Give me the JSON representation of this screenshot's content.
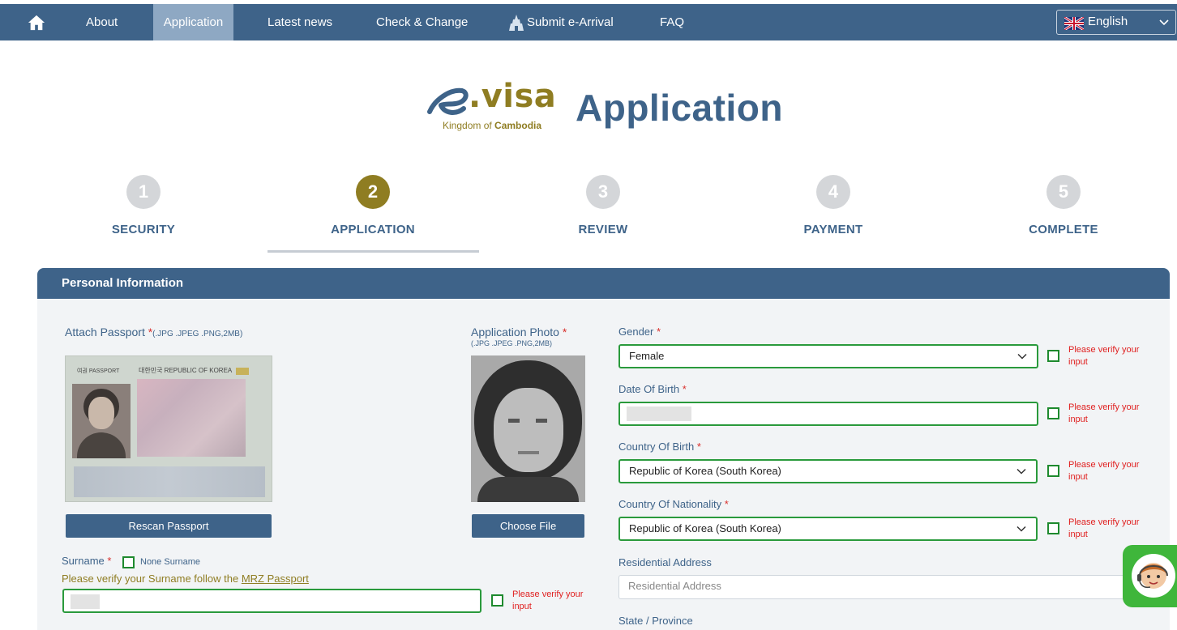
{
  "nav": {
    "items": [
      "About",
      "Application",
      "Latest news",
      "Check & Change",
      "Submit e-Arrival",
      "FAQ"
    ],
    "language": "English"
  },
  "logo": {
    "brand": "e.visa",
    "subtitle_plain": "Kingdom of ",
    "subtitle_bold": "Cambodia"
  },
  "page_title": "Application",
  "steps": [
    {
      "num": "1",
      "label": "SECURITY"
    },
    {
      "num": "2",
      "label": "APPLICATION"
    },
    {
      "num": "3",
      "label": "REVIEW"
    },
    {
      "num": "4",
      "label": "PAYMENT"
    },
    {
      "num": "5",
      "label": "COMPLETE"
    }
  ],
  "panel": {
    "title": "Personal Information"
  },
  "passport": {
    "label": "Attach Passport",
    "required": "*",
    "formats": "(.JPG .JPEG .PNG,2MB)",
    "button": "Rescan Passport",
    "header_left": "여권 PASSPORT",
    "header_right": "대한민국  REPUBLIC OF KOREA"
  },
  "photo": {
    "label": "Application Photo",
    "required": "*",
    "formats": "(.JPG .JPEG .PNG,2MB)",
    "button": "Choose File"
  },
  "surname": {
    "label": "Surname",
    "required": "*",
    "none_label": "None Surname",
    "hint_prefix": "Please verify your Surname follow the ",
    "hint_link": "MRZ Passport",
    "verify": "Please verify your input"
  },
  "gender": {
    "label": "Gender",
    "required": "*",
    "value": "Female",
    "verify": "Please verify your input"
  },
  "dob": {
    "label": "Date Of Birth",
    "required": "*",
    "verify": "Please verify your input"
  },
  "country_birth": {
    "label": "Country Of Birth",
    "required": "*",
    "value": "Republic of Korea (South Korea)",
    "verify": "Please verify your input"
  },
  "country_nationality": {
    "label": "Country Of Nationality",
    "required": "*",
    "value": "Republic of Korea (South Korea)",
    "verify": "Please verify your input"
  },
  "residential": {
    "label": "Residential Address",
    "placeholder": "Residential Address"
  },
  "state": {
    "label": "State / Province"
  },
  "colors": {
    "primary": "#3e6389",
    "accent": "#8f7d22",
    "valid": "#2a9a3c",
    "error": "#e02020",
    "chat": "#3fb63b"
  }
}
